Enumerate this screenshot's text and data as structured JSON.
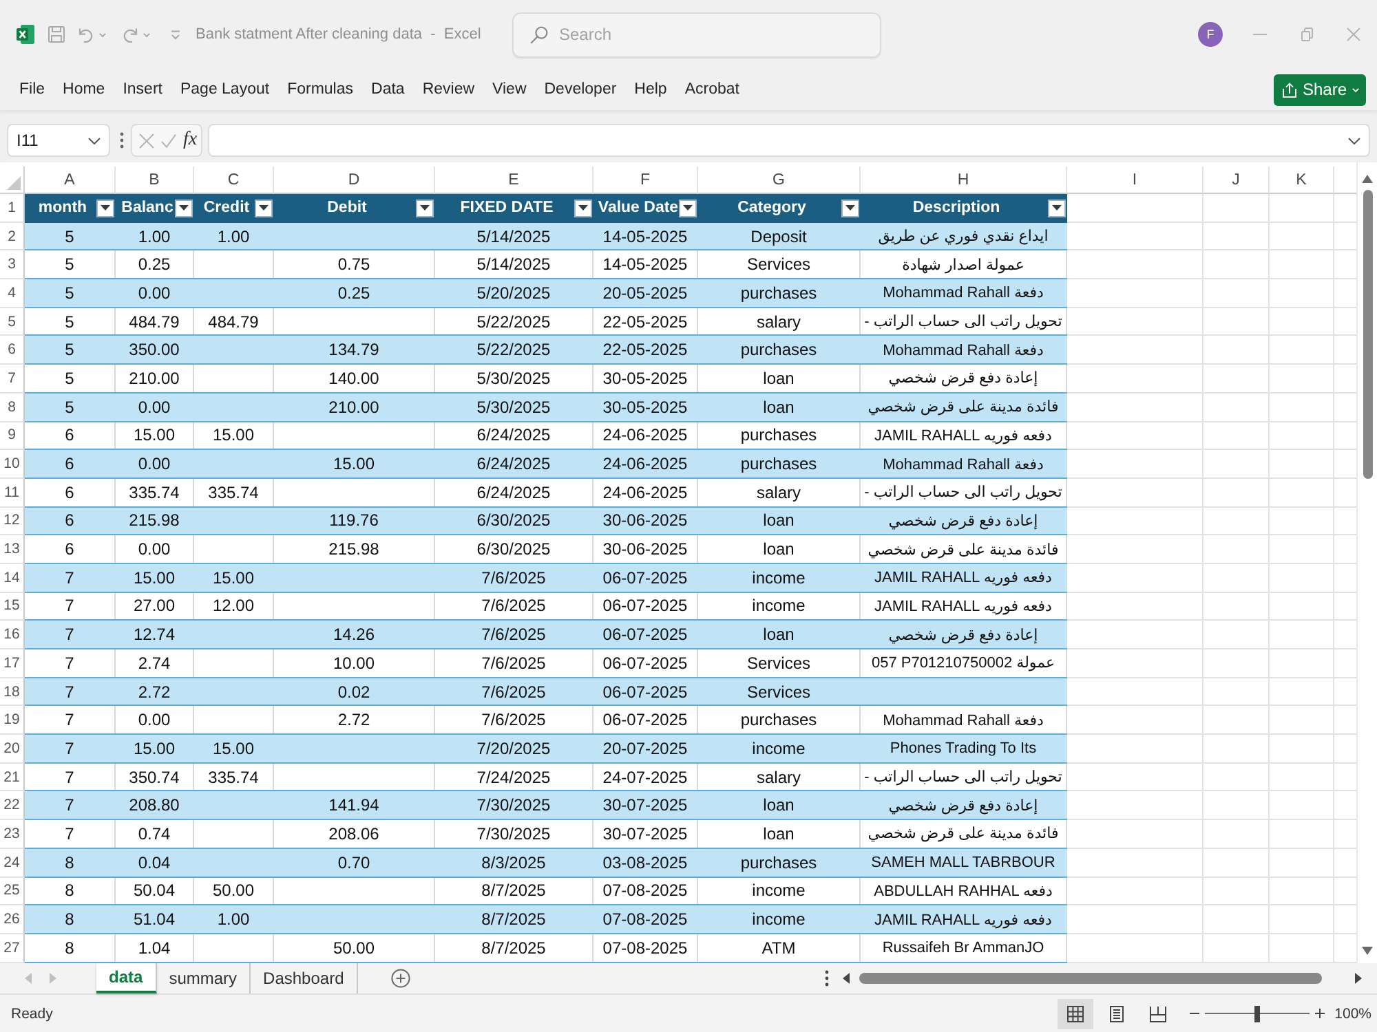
{
  "window": {
    "title": "Bank statment After cleaning data  -  Excel"
  },
  "title_bar": {
    "search": {
      "placeholder": "Search"
    },
    "account_initial": "F"
  },
  "ribbon": {
    "tabs": [
      "File",
      "Home",
      "Insert",
      "Page Layout",
      "Formulas",
      "Data",
      "Review",
      "View",
      "Developer",
      "Help",
      "Acrobat"
    ],
    "share_button": "Share"
  },
  "formula_bar": {
    "name_box": "I11",
    "function_button": "fx"
  },
  "sheet": {
    "column_letters": [
      "A",
      "B",
      "C",
      "D",
      "E",
      "F",
      "G",
      "H",
      "I",
      "J",
      "K"
    ],
    "header_row": {
      "row_number": "1",
      "labels": [
        "month",
        "Balanc",
        "Credit",
        "Debit",
        "FIXED DATE",
        "Value Date",
        "Category",
        "Description"
      ]
    },
    "rows": [
      {
        "row_number": "2",
        "month": "5",
        "balance": "1.00",
        "credit": "1.00",
        "fixed_date": "5/14/2025",
        "value_date": "14-05-2025",
        "category": "Deposit",
        "description": "ايداع نقدي فوري عن طريق"
      },
      {
        "row_number": "3",
        "month": "5",
        "balance": "0.25",
        "debit": "0.75",
        "fixed_date": "5/14/2025",
        "value_date": "14-05-2025",
        "category": "Services",
        "description": "عمولة اصدار شهادة"
      },
      {
        "row_number": "4",
        "month": "5",
        "balance": "0.00",
        "debit": "0.25",
        "fixed_date": "5/20/2025",
        "value_date": "20-05-2025",
        "category": "purchases",
        "description": "Mohammad Rahall دفعة"
      },
      {
        "row_number": "5",
        "month": "5",
        "balance": "484.79",
        "credit": "484.79",
        "fixed_date": "5/22/2025",
        "value_date": "22-05-2025",
        "category": "salary",
        "description": "تحويل راتب الى حساب الراتب -"
      },
      {
        "row_number": "6",
        "month": "5",
        "balance": "350.00",
        "debit": "134.79",
        "fixed_date": "5/22/2025",
        "value_date": "22-05-2025",
        "category": "purchases",
        "description": "Mohammad Rahall دفعة"
      },
      {
        "row_number": "7",
        "month": "5",
        "balance": "210.00",
        "debit": "140.00",
        "fixed_date": "5/30/2025",
        "value_date": "30-05-2025",
        "category": "loan",
        "description": "إعادة دفع قرض شخصي"
      },
      {
        "row_number": "8",
        "month": "5",
        "balance": "0.00",
        "debit": "210.00",
        "fixed_date": "5/30/2025",
        "value_date": "30-05-2025",
        "category": "loan",
        "description": "فائدة مدينة على قرض شخصي"
      },
      {
        "row_number": "9",
        "month": "6",
        "balance": "15.00",
        "credit": "15.00",
        "fixed_date": "6/24/2025",
        "value_date": "24-06-2025",
        "category": "purchases",
        "description": "JAMIL RAHALL دفعه فوريه"
      },
      {
        "row_number": "10",
        "month": "6",
        "balance": "0.00",
        "debit": "15.00",
        "fixed_date": "6/24/2025",
        "value_date": "24-06-2025",
        "category": "purchases",
        "description": "Mohammad Rahall دفعة"
      },
      {
        "row_number": "11",
        "month": "6",
        "balance": "335.74",
        "credit": "335.74",
        "fixed_date": "6/24/2025",
        "value_date": "24-06-2025",
        "category": "salary",
        "description": "تحويل راتب الى حساب الراتب -"
      },
      {
        "row_number": "12",
        "month": "6",
        "balance": "215.98",
        "debit": "119.76",
        "fixed_date": "6/30/2025",
        "value_date": "30-06-2025",
        "category": "loan",
        "description": "إعادة دفع قرض شخصي"
      },
      {
        "row_number": "13",
        "month": "6",
        "balance": "0.00",
        "debit": "215.98",
        "fixed_date": "6/30/2025",
        "value_date": "30-06-2025",
        "category": "loan",
        "description": "فائدة مدينة على قرض شخصي"
      },
      {
        "row_number": "14",
        "month": "7",
        "balance": "15.00",
        "credit": "15.00",
        "fixed_date": "7/6/2025",
        "value_date": "06-07-2025",
        "category": "income",
        "description": "JAMIL RAHALL دفعه فوريه"
      },
      {
        "row_number": "15",
        "month": "7",
        "balance": "27.00",
        "credit": "12.00",
        "fixed_date": "7/6/2025",
        "value_date": "06-07-2025",
        "category": "income",
        "description": "JAMIL RAHALL دفعه فوريه"
      },
      {
        "row_number": "16",
        "month": "7",
        "balance": "12.74",
        "debit": "14.26",
        "fixed_date": "7/6/2025",
        "value_date": "06-07-2025",
        "category": "loan",
        "description": "إعادة دفع قرض شخصي"
      },
      {
        "row_number": "17",
        "month": "7",
        "balance": "2.74",
        "debit": "10.00",
        "fixed_date": "7/6/2025",
        "value_date": "06-07-2025",
        "category": "Services",
        "description": "057 P701210750002 عمولة"
      },
      {
        "row_number": "18",
        "month": "7",
        "balance": "2.72",
        "debit": "0.02",
        "fixed_date": "7/6/2025",
        "value_date": "06-07-2025",
        "category": "Services"
      },
      {
        "row_number": "19",
        "month": "7",
        "balance": "0.00",
        "debit": "2.72",
        "fixed_date": "7/6/2025",
        "value_date": "06-07-2025",
        "category": "purchases",
        "description": "Mohammad Rahall دفعة"
      },
      {
        "row_number": "20",
        "month": "7",
        "balance": "15.00",
        "credit": "15.00",
        "fixed_date": "7/20/2025",
        "value_date": "20-07-2025",
        "category": "income",
        "description": "Phones Trading To Its"
      },
      {
        "row_number": "21",
        "month": "7",
        "balance": "350.74",
        "credit": "335.74",
        "fixed_date": "7/24/2025",
        "value_date": "24-07-2025",
        "category": "salary",
        "description": "تحويل راتب الى حساب الراتب -"
      },
      {
        "row_number": "22",
        "month": "7",
        "balance": "208.80",
        "debit": "141.94",
        "fixed_date": "7/30/2025",
        "value_date": "30-07-2025",
        "category": "loan",
        "description": "إعادة دفع قرض شخصي"
      },
      {
        "row_number": "23",
        "month": "7",
        "balance": "0.74",
        "debit": "208.06",
        "fixed_date": "7/30/2025",
        "value_date": "30-07-2025",
        "category": "loan",
        "description": "فائدة مدينة على قرض شخصي"
      },
      {
        "row_number": "24",
        "month": "8",
        "balance": "0.04",
        "debit": "0.70",
        "fixed_date": "8/3/2025",
        "value_date": "03-08-2025",
        "category": "purchases",
        "description": "SAMEH MALL TABRBOUR"
      },
      {
        "row_number": "25",
        "month": "8",
        "balance": "50.04",
        "credit": "50.00",
        "fixed_date": "8/7/2025",
        "value_date": "07-08-2025",
        "category": "income",
        "description": "ABDULLAH RAHHAL دفعه"
      },
      {
        "row_number": "26",
        "month": "8",
        "balance": "51.04",
        "credit": "1.00",
        "fixed_date": "8/7/2025",
        "value_date": "07-08-2025",
        "category": "income",
        "description": "JAMIL RAHALL دفعه فوريه"
      },
      {
        "row_number": "27",
        "month": "8",
        "balance": "1.04",
        "debit": "50.00",
        "fixed_date": "8/7/2025",
        "value_date": "07-08-2025",
        "category": "ATM",
        "description": "Russaifeh Br AmmanJO"
      }
    ]
  },
  "sheet_tabs": [
    {
      "label": "data",
      "selected": true
    },
    {
      "label": "summary",
      "selected": false
    },
    {
      "label": "Dashboard",
      "selected": false
    }
  ],
  "status_bar": {
    "text": "Ready",
    "view_buttons": [
      {
        "kind": "normal",
        "selected": true
      },
      {
        "kind": "page_layout",
        "selected": false
      },
      {
        "kind": "page_break",
        "selected": false
      }
    ],
    "zoom": {
      "level": 0.5,
      "reading": "100%"
    }
  }
}
